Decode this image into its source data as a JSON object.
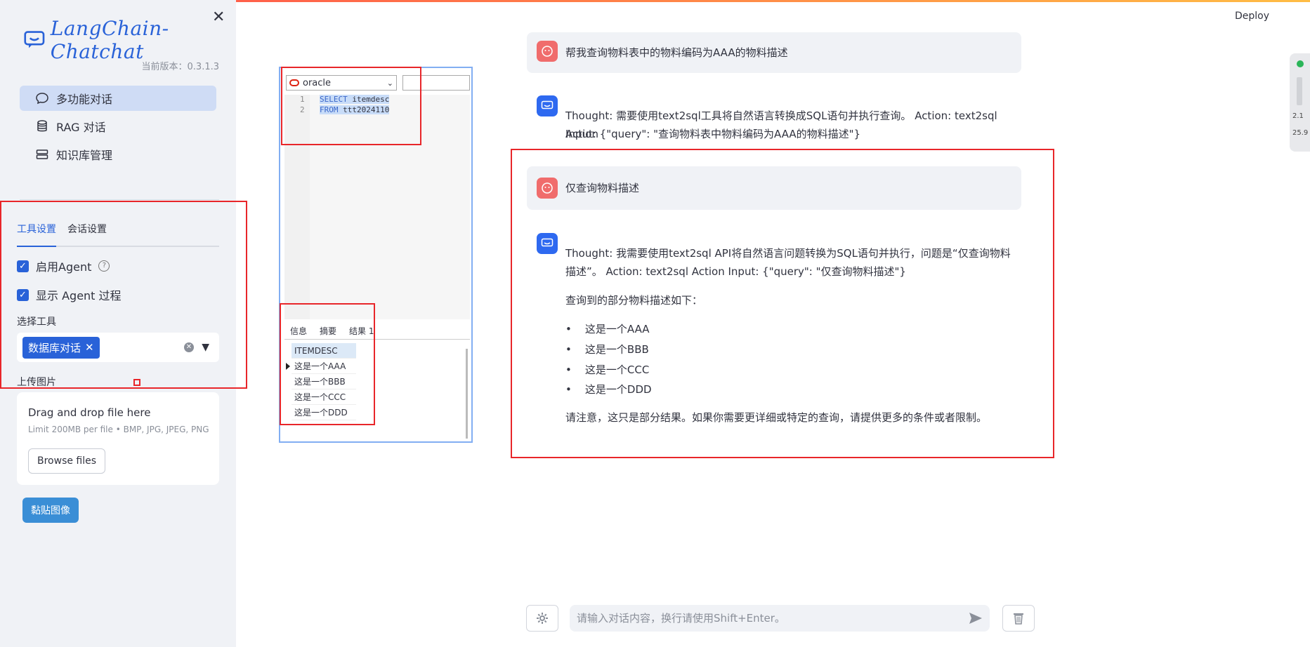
{
  "app": {
    "logo_text": "LangChain-Chatchat",
    "version": "当前版本：0.3.1.3",
    "deploy": "Deploy"
  },
  "nav": {
    "items": [
      {
        "label": "多功能对话"
      },
      {
        "label": "RAG 对话"
      },
      {
        "label": "知识库管理"
      }
    ]
  },
  "settings": {
    "tabs": [
      "工具设置",
      "会话设置"
    ],
    "enable_agent": "启用Agent",
    "show_agent_process": "显示 Agent 过程",
    "select_tool_label": "选择工具",
    "selected_tool": "数据库对话",
    "upload_label": "上传图片",
    "upload_title": "Drag and drop file here",
    "upload_limits": "Limit 200MB per file • BMP, JPG, JPEG, PNG",
    "browse": "Browse files",
    "paste": "黏贴图像"
  },
  "screenshot": {
    "db": "oracle",
    "lines": [
      "1",
      "2"
    ],
    "code1_kw": "SELECT",
    "code1_rest": " itemdesc",
    "code2_kw": "FROM",
    "code2_rest": " ttt2024110",
    "result_tabs": [
      "信息",
      "摘要",
      "结果 1"
    ],
    "grid_header": "ITEMDESC",
    "grid_rows": [
      "这是一个AAA",
      "这是一个BBB",
      "这是一个CCC",
      "这是一个DDD"
    ]
  },
  "chat": {
    "messages": [
      {
        "role": "user",
        "text": "帮我查询物料表中的物料编码为AAA的物料描述"
      },
      {
        "role": "assistant",
        "text_1": "Thought: 需要使用text2sql工具将自然语言转换成SQL语句并执行查询。 Action: text2sql Action",
        "text_2": "Input: {\"query\": \"查询物料表中物料编码为AAA的物料描述\"}"
      },
      {
        "role": "user",
        "text": "仅查询物料描述"
      },
      {
        "role": "assistant",
        "text_1": "Thought: 我需要使用text2sql API将自然语言问题转换为SQL语句并执行，问题是“仅查询物料",
        "text_2": "描述”。 Action: text2sql Action Input: {\"query\": \"仅查询物料描述\"}",
        "intro": "查询到的部分物料描述如下：",
        "items": [
          "这是一个AAA",
          "这是一个BBB",
          "这是一个CCC",
          "这是一个DDD"
        ],
        "note": "请注意，这只是部分结果。如果你需要更详细或特定的查询，请提供更多的条件或者限制。"
      }
    ],
    "input_placeholder": "请输入对话内容，换行请使用Shift+Enter。"
  },
  "widget": {
    "n1": "2.1",
    "n2": "25.9"
  }
}
